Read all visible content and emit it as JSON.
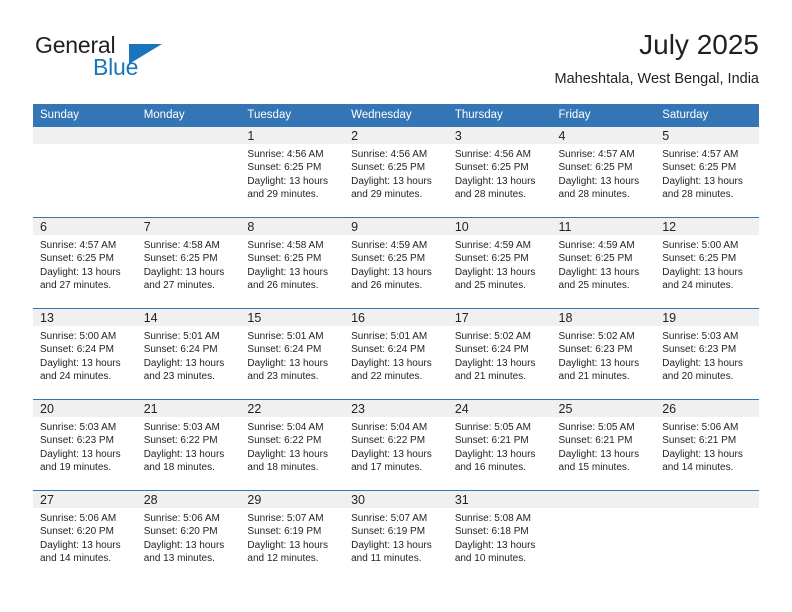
{
  "logo": {
    "word_one": "General",
    "word_two": "Blue",
    "triangle_color": "#1b75bb",
    "text_color": "#231f20"
  },
  "header": {
    "title": "July 2025",
    "subtitle": "Maheshtala, West Bengal, India"
  },
  "theme": {
    "header_bar": "#3375b5",
    "daynum_band": "#f0f0f0",
    "text": "#231f20"
  },
  "weekdays": [
    "Sunday",
    "Monday",
    "Tuesday",
    "Wednesday",
    "Thursday",
    "Friday",
    "Saturday"
  ],
  "weeks": [
    [
      {
        "day": "",
        "sunrise": "",
        "sunset": "",
        "daylight_1": "",
        "daylight_2": ""
      },
      {
        "day": "",
        "sunrise": "",
        "sunset": "",
        "daylight_1": "",
        "daylight_2": ""
      },
      {
        "day": "1",
        "sunrise": "Sunrise: 4:56 AM",
        "sunset": "Sunset: 6:25 PM",
        "daylight_1": "Daylight: 13 hours",
        "daylight_2": "and 29 minutes."
      },
      {
        "day": "2",
        "sunrise": "Sunrise: 4:56 AM",
        "sunset": "Sunset: 6:25 PM",
        "daylight_1": "Daylight: 13 hours",
        "daylight_2": "and 29 minutes."
      },
      {
        "day": "3",
        "sunrise": "Sunrise: 4:56 AM",
        "sunset": "Sunset: 6:25 PM",
        "daylight_1": "Daylight: 13 hours",
        "daylight_2": "and 28 minutes."
      },
      {
        "day": "4",
        "sunrise": "Sunrise: 4:57 AM",
        "sunset": "Sunset: 6:25 PM",
        "daylight_1": "Daylight: 13 hours",
        "daylight_2": "and 28 minutes."
      },
      {
        "day": "5",
        "sunrise": "Sunrise: 4:57 AM",
        "sunset": "Sunset: 6:25 PM",
        "daylight_1": "Daylight: 13 hours",
        "daylight_2": "and 28 minutes."
      }
    ],
    [
      {
        "day": "6",
        "sunrise": "Sunrise: 4:57 AM",
        "sunset": "Sunset: 6:25 PM",
        "daylight_1": "Daylight: 13 hours",
        "daylight_2": "and 27 minutes."
      },
      {
        "day": "7",
        "sunrise": "Sunrise: 4:58 AM",
        "sunset": "Sunset: 6:25 PM",
        "daylight_1": "Daylight: 13 hours",
        "daylight_2": "and 27 minutes."
      },
      {
        "day": "8",
        "sunrise": "Sunrise: 4:58 AM",
        "sunset": "Sunset: 6:25 PM",
        "daylight_1": "Daylight: 13 hours",
        "daylight_2": "and 26 minutes."
      },
      {
        "day": "9",
        "sunrise": "Sunrise: 4:59 AM",
        "sunset": "Sunset: 6:25 PM",
        "daylight_1": "Daylight: 13 hours",
        "daylight_2": "and 26 minutes."
      },
      {
        "day": "10",
        "sunrise": "Sunrise: 4:59 AM",
        "sunset": "Sunset: 6:25 PM",
        "daylight_1": "Daylight: 13 hours",
        "daylight_2": "and 25 minutes."
      },
      {
        "day": "11",
        "sunrise": "Sunrise: 4:59 AM",
        "sunset": "Sunset: 6:25 PM",
        "daylight_1": "Daylight: 13 hours",
        "daylight_2": "and 25 minutes."
      },
      {
        "day": "12",
        "sunrise": "Sunrise: 5:00 AM",
        "sunset": "Sunset: 6:25 PM",
        "daylight_1": "Daylight: 13 hours",
        "daylight_2": "and 24 minutes."
      }
    ],
    [
      {
        "day": "13",
        "sunrise": "Sunrise: 5:00 AM",
        "sunset": "Sunset: 6:24 PM",
        "daylight_1": "Daylight: 13 hours",
        "daylight_2": "and 24 minutes."
      },
      {
        "day": "14",
        "sunrise": "Sunrise: 5:01 AM",
        "sunset": "Sunset: 6:24 PM",
        "daylight_1": "Daylight: 13 hours",
        "daylight_2": "and 23 minutes."
      },
      {
        "day": "15",
        "sunrise": "Sunrise: 5:01 AM",
        "sunset": "Sunset: 6:24 PM",
        "daylight_1": "Daylight: 13 hours",
        "daylight_2": "and 23 minutes."
      },
      {
        "day": "16",
        "sunrise": "Sunrise: 5:01 AM",
        "sunset": "Sunset: 6:24 PM",
        "daylight_1": "Daylight: 13 hours",
        "daylight_2": "and 22 minutes."
      },
      {
        "day": "17",
        "sunrise": "Sunrise: 5:02 AM",
        "sunset": "Sunset: 6:24 PM",
        "daylight_1": "Daylight: 13 hours",
        "daylight_2": "and 21 minutes."
      },
      {
        "day": "18",
        "sunrise": "Sunrise: 5:02 AM",
        "sunset": "Sunset: 6:23 PM",
        "daylight_1": "Daylight: 13 hours",
        "daylight_2": "and 21 minutes."
      },
      {
        "day": "19",
        "sunrise": "Sunrise: 5:03 AM",
        "sunset": "Sunset: 6:23 PM",
        "daylight_1": "Daylight: 13 hours",
        "daylight_2": "and 20 minutes."
      }
    ],
    [
      {
        "day": "20",
        "sunrise": "Sunrise: 5:03 AM",
        "sunset": "Sunset: 6:23 PM",
        "daylight_1": "Daylight: 13 hours",
        "daylight_2": "and 19 minutes."
      },
      {
        "day": "21",
        "sunrise": "Sunrise: 5:03 AM",
        "sunset": "Sunset: 6:22 PM",
        "daylight_1": "Daylight: 13 hours",
        "daylight_2": "and 18 minutes."
      },
      {
        "day": "22",
        "sunrise": "Sunrise: 5:04 AM",
        "sunset": "Sunset: 6:22 PM",
        "daylight_1": "Daylight: 13 hours",
        "daylight_2": "and 18 minutes."
      },
      {
        "day": "23",
        "sunrise": "Sunrise: 5:04 AM",
        "sunset": "Sunset: 6:22 PM",
        "daylight_1": "Daylight: 13 hours",
        "daylight_2": "and 17 minutes."
      },
      {
        "day": "24",
        "sunrise": "Sunrise: 5:05 AM",
        "sunset": "Sunset: 6:21 PM",
        "daylight_1": "Daylight: 13 hours",
        "daylight_2": "and 16 minutes."
      },
      {
        "day": "25",
        "sunrise": "Sunrise: 5:05 AM",
        "sunset": "Sunset: 6:21 PM",
        "daylight_1": "Daylight: 13 hours",
        "daylight_2": "and 15 minutes."
      },
      {
        "day": "26",
        "sunrise": "Sunrise: 5:06 AM",
        "sunset": "Sunset: 6:21 PM",
        "daylight_1": "Daylight: 13 hours",
        "daylight_2": "and 14 minutes."
      }
    ],
    [
      {
        "day": "27",
        "sunrise": "Sunrise: 5:06 AM",
        "sunset": "Sunset: 6:20 PM",
        "daylight_1": "Daylight: 13 hours",
        "daylight_2": "and 14 minutes."
      },
      {
        "day": "28",
        "sunrise": "Sunrise: 5:06 AM",
        "sunset": "Sunset: 6:20 PM",
        "daylight_1": "Daylight: 13 hours",
        "daylight_2": "and 13 minutes."
      },
      {
        "day": "29",
        "sunrise": "Sunrise: 5:07 AM",
        "sunset": "Sunset: 6:19 PM",
        "daylight_1": "Daylight: 13 hours",
        "daylight_2": "and 12 minutes."
      },
      {
        "day": "30",
        "sunrise": "Sunrise: 5:07 AM",
        "sunset": "Sunset: 6:19 PM",
        "daylight_1": "Daylight: 13 hours",
        "daylight_2": "and 11 minutes."
      },
      {
        "day": "31",
        "sunrise": "Sunrise: 5:08 AM",
        "sunset": "Sunset: 6:18 PM",
        "daylight_1": "Daylight: 13 hours",
        "daylight_2": "and 10 minutes."
      },
      {
        "day": "",
        "sunrise": "",
        "sunset": "",
        "daylight_1": "",
        "daylight_2": ""
      },
      {
        "day": "",
        "sunrise": "",
        "sunset": "",
        "daylight_1": "",
        "daylight_2": ""
      }
    ]
  ]
}
